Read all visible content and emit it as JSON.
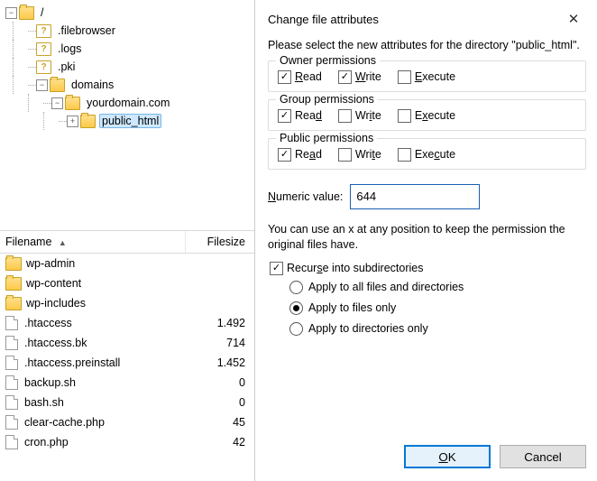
{
  "tree": {
    "root": "/",
    "items": [
      ".filebrowser",
      ".logs",
      ".pki"
    ],
    "domains": "domains",
    "domain": "yourdomain.com",
    "selected": "public_html"
  },
  "columns": {
    "name": "Filename",
    "size": "Filesize"
  },
  "files": [
    {
      "name": "wp-admin",
      "type": "folder",
      "size": ""
    },
    {
      "name": "wp-content",
      "type": "folder",
      "size": ""
    },
    {
      "name": "wp-includes",
      "type": "folder",
      "size": ""
    },
    {
      "name": ".htaccess",
      "type": "file",
      "size": "1.492"
    },
    {
      "name": ".htaccess.bk",
      "type": "file",
      "size": "714"
    },
    {
      "name": ".htaccess.preinstall",
      "type": "file",
      "size": "1.452"
    },
    {
      "name": "backup.sh",
      "type": "file",
      "size": "0"
    },
    {
      "name": "bash.sh",
      "type": "file",
      "size": "0"
    },
    {
      "name": "clear-cache.php",
      "type": "file",
      "size": "45"
    },
    {
      "name": "cron.php",
      "type": "file",
      "size": "42"
    }
  ],
  "dialog": {
    "title": "Change file attributes",
    "intro": "Please select the new attributes for the directory \"public_html\".",
    "groups": {
      "owner": {
        "title": "Owner permissions",
        "read": "Read",
        "write": "Write",
        "exec": "Execute",
        "r": true,
        "w": true,
        "x": false
      },
      "group": {
        "title": "Group permissions",
        "read": "Read",
        "write": "Write",
        "exec": "Execute",
        "r": true,
        "w": false,
        "x": false
      },
      "public": {
        "title": "Public permissions",
        "read": "Read",
        "write": "Write",
        "exec": "Execute",
        "r": true,
        "w": false,
        "x": false
      }
    },
    "numeric_label": "Numeric value:",
    "numeric_value": "644",
    "note": "You can use an x at any position to keep the permission the original files have.",
    "recurse_label": "Recurse into subdirectories",
    "recurse": true,
    "radios": {
      "all": "Apply to all files and directories",
      "files": "Apply to files only",
      "dirs": "Apply to directories only",
      "selected": "files"
    },
    "ok": "OK",
    "cancel": "Cancel"
  }
}
